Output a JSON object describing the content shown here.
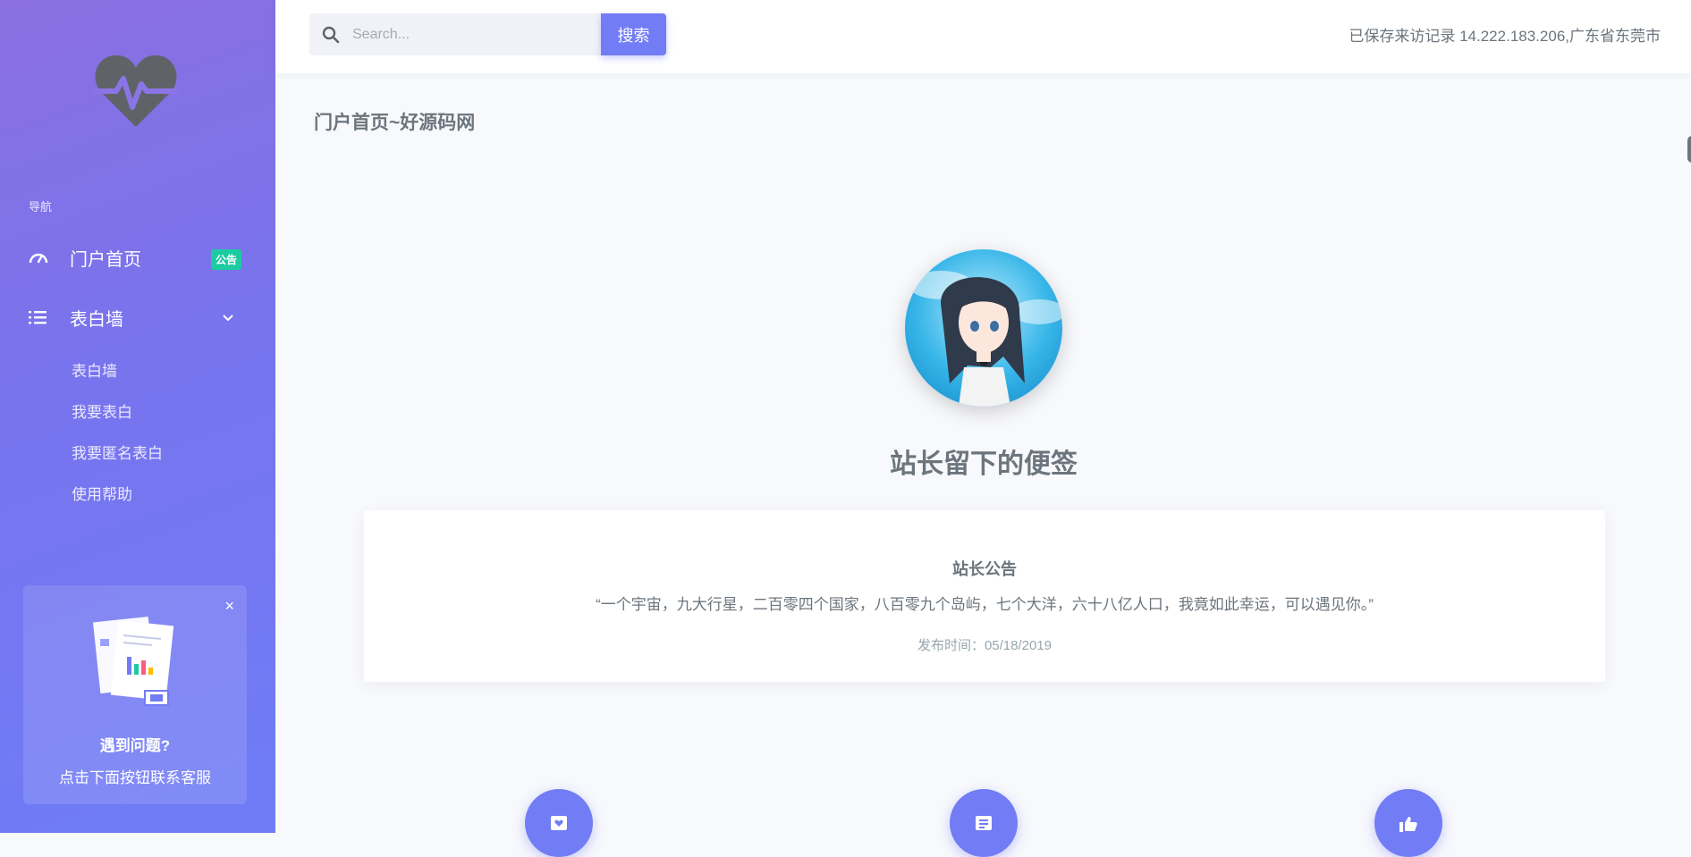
{
  "sidebar": {
    "nav_heading": "导航",
    "items": [
      {
        "label": "门户首页",
        "badge": "公告",
        "icon": "dashboard-icon"
      },
      {
        "label": "表白墙",
        "icon": "list-icon"
      }
    ],
    "sub_items": [
      "表白墙",
      "我要表白",
      "我要匿名表白",
      "使用帮助"
    ],
    "help_card": {
      "close": "×",
      "title": "遇到问题?",
      "subtitle": "点击下面按钮联系客服"
    }
  },
  "topbar": {
    "search_placeholder": "Search...",
    "search_button": "搜索",
    "visitor_text": "已保存来访记录 14.222.183.206,广东省东莞市"
  },
  "main": {
    "page_title": "门户首页~好源码网",
    "note_title": "站长留下的便签",
    "notice": {
      "title": "站长公告",
      "text": "“一个宇宙，九大行星，二百零四个国家，八百零九个岛屿，七个大洋，六十八亿人口，我竟如此幸运，可以遇见你。”",
      "date": "发布时间：05/18/2019"
    },
    "features": [
      "heart-box-icon",
      "note-icon",
      "thumbs-up-icon"
    ]
  },
  "colors": {
    "primary": "#727cf5",
    "badge": "#1ccca0",
    "text_muted": "#6c757d"
  }
}
